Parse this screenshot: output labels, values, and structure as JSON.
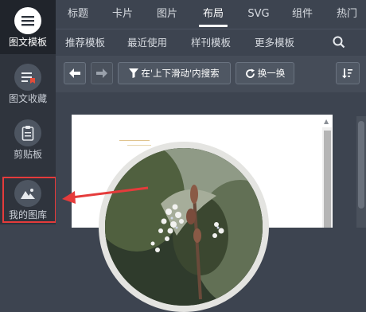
{
  "sidebar": {
    "items": [
      {
        "label": "图文模板",
        "icon": "list-icon",
        "active": true
      },
      {
        "label": "图文收藏",
        "icon": "bookmark-icon",
        "active": false
      },
      {
        "label": "剪贴板",
        "icon": "clipboard-icon",
        "active": false
      },
      {
        "label": "我的图库",
        "icon": "image-icon",
        "active": false
      }
    ]
  },
  "topnav": {
    "tabs": [
      {
        "label": "标题",
        "active": false
      },
      {
        "label": "卡片",
        "active": false
      },
      {
        "label": "图片",
        "active": false
      },
      {
        "label": "布局",
        "active": true
      },
      {
        "label": "SVG",
        "active": false
      },
      {
        "label": "组件",
        "active": false
      },
      {
        "label": "热门",
        "active": false
      }
    ]
  },
  "subnav": {
    "items": [
      "推荐模板",
      "最近使用",
      "样刊模板",
      "更多模板"
    ],
    "search_icon": "search-icon"
  },
  "toolbar": {
    "back_icon": "arrow-left-icon",
    "forward_icon": "arrow-right-icon",
    "filter_label": "在'上下滑动'内搜索",
    "filter_icon": "filter-icon",
    "refresh_label": "换一换",
    "refresh_icon": "refresh-icon",
    "sort_icon": "sort-icon"
  },
  "colors": {
    "sidebar_bg": "#2f343d",
    "nav_bg": "#3d4450",
    "highlight": "#e53b3b"
  }
}
